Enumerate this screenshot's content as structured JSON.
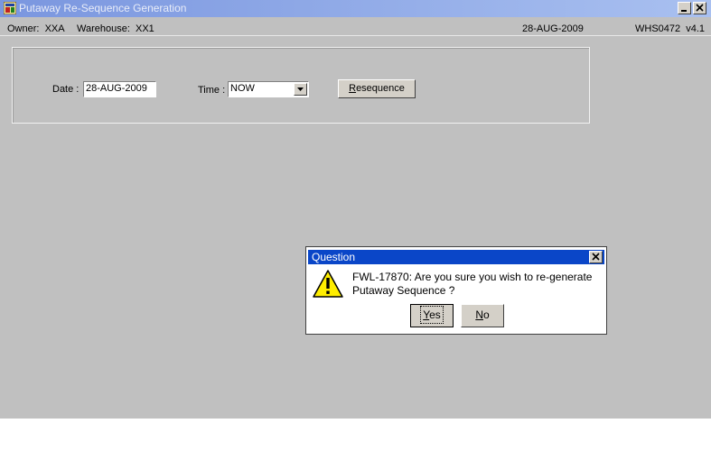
{
  "window": {
    "title": "Putaway Re-Sequence Generation"
  },
  "status": {
    "owner": "Owner:  XXA",
    "warehouse": "Warehouse:  XX1",
    "date": "28-AUG-2009",
    "version": "WHS0472  v4.1"
  },
  "form": {
    "date_label": "Date :",
    "date_value": "28-AUG-2009",
    "time_label": "Time :",
    "time_value": "NOW",
    "resequence_first": "R",
    "resequence_rest": "esequence"
  },
  "dialog": {
    "title": "Question",
    "message": "FWL-17870:  Are you sure you wish to re-generate Putaway Sequence ?",
    "yes_first": "Y",
    "yes_rest": "es",
    "no_first": "N",
    "no_rest": "o"
  },
  "icons": [
    "app-icon",
    "minimize-icon",
    "close-icon",
    "dropdown-arrow-icon",
    "warning-icon"
  ]
}
